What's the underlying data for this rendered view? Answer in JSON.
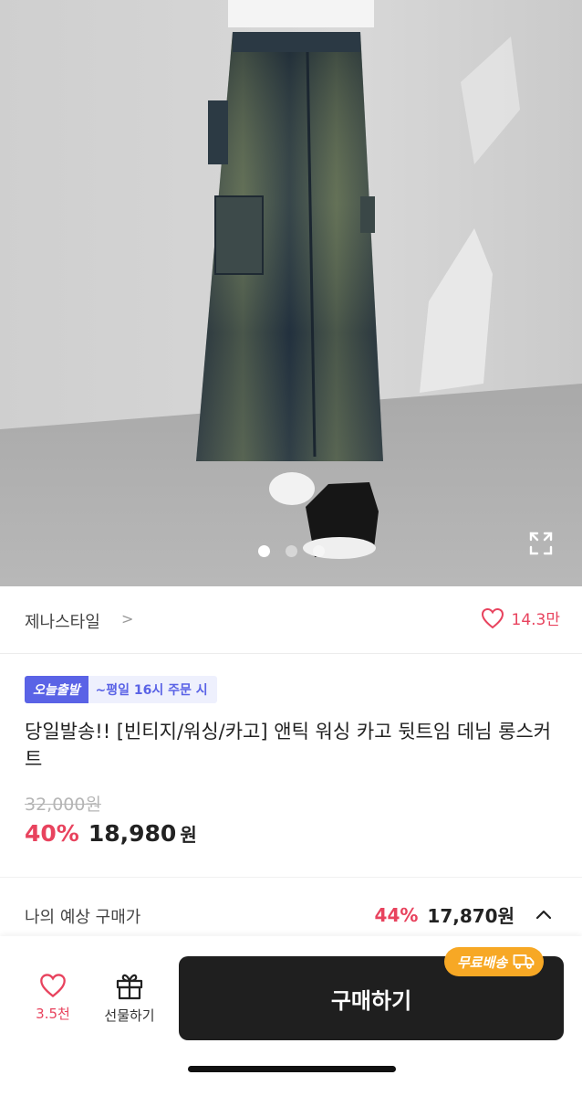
{
  "image": {
    "alt_icon": "product-photo",
    "dots": [
      {
        "active": true
      },
      {
        "active": false
      },
      {
        "active": false
      }
    ],
    "expand_icon": "expand-icon"
  },
  "seller": {
    "name": "제나스타일",
    "chevron": ">",
    "likes": "14.3만"
  },
  "badge": {
    "main": "오늘출발",
    "sub": "~평일 16시 주문 시"
  },
  "product": {
    "title": " 당일발송!! [빈티지/워싱/카고] 앤틱 워싱 카고 뒷트임 데님 롱스커트",
    "original_price": "32,000원",
    "discount": "40%",
    "price": "18,980",
    "currency": "원"
  },
  "expected": {
    "label": "나의 예상 구매가",
    "discount": "44%",
    "price": "17,870원"
  },
  "bottom_bar": {
    "like_count": "3.5천",
    "gift_label": "선물하기",
    "buy_label": "구매하기",
    "free_shipping": "무료배송"
  },
  "colors": {
    "accent_pink": "#e8435e",
    "badge_blue": "#5a63e6",
    "shipping_orange": "#f7a825",
    "button_dark": "#1f1f1f"
  }
}
